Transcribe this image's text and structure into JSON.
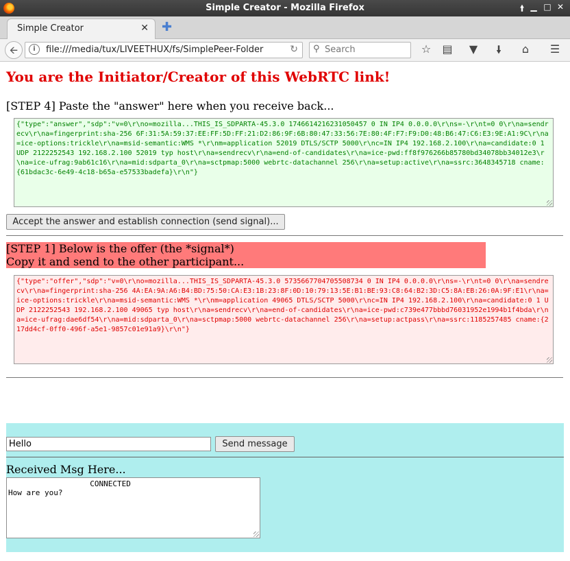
{
  "window": {
    "title": "Simple Creator - Mozilla Firefox"
  },
  "tabs": [
    {
      "label": "Simple Creator"
    }
  ],
  "toolbar": {
    "url": "file:///media/tux/LIVEETHUX/fs/SimplePeer-Folder",
    "search_placeholder": "Search"
  },
  "page": {
    "heading": "You are the Initiator/Creator of this WebRTC link!",
    "step4_label": "[STEP 4] Paste the \"answer\" here when you receive back...",
    "answer_text": "{\"type\":\"answer\",\"sdp\":\"v=0\\r\\no=mozilla...THIS_IS_SDPARTA-45.3.0 1746614216231050457 0 IN IP4 0.0.0.0\\r\\ns=-\\r\\nt=0 0\\r\\na=sendrecv\\r\\na=fingerprint:sha-256 6F:31:5A:59:37:EE:FF:5D:FF:21:D2:86:9F:6B:80:47:33:56:7E:80:4F:F7:F9:D0:48:B6:47:C6:E3:9E:A1:9C\\r\\na=ice-options:trickle\\r\\na=msid-semantic:WMS *\\r\\nm=application 52019 DTLS/SCTP 5000\\r\\nc=IN IP4 192.168.2.100\\r\\na=candidate:0 1 UDP 2122252543 192.168.2.100 52019 typ host\\r\\na=sendrecv\\r\\na=end-of-candidates\\r\\na=ice-pwd:ff8f976266b85780bd34078bb34012e3\\r\\na=ice-ufrag:9ab61c16\\r\\na=mid:sdparta_0\\r\\na=sctpmap:5000 webrtc-datachannel 256\\r\\na=setup:active\\r\\na=ssrc:3648345718 cname:{61bdac3c-6e49-4c18-b65a-e57533badefa}\\r\\n\"}",
    "accept_button": "Accept the answer and establish connection (send signal)...",
    "step1_line1": "[STEP 1] Below is the offer (the *signal*)",
    "step1_line2": "Copy it and send to the other participant...",
    "offer_text": "{\"type\":\"offer\",\"sdp\":\"v=0\\r\\no=mozilla...THIS_IS_SDPARTA-45.3.0 5735667704705508734 0 IN IP4 0.0.0.0\\r\\ns=-\\r\\nt=0 0\\r\\na=sendrecv\\r\\na=fingerprint:sha-256 4A:EA:9A:A6:B4:BD:75:50:CA:E3:1B:23:8F:0D:10:79:13:5E:B1:BE:93:C8:64:B2:3D:C5:8A:EB:26:0A:9F:E1\\r\\na=ice-options:trickle\\r\\na=msid-semantic:WMS *\\r\\nm=application 49065 DTLS/SCTP 5000\\r\\nc=IN IP4 192.168.2.100\\r\\na=candidate:0 1 UDP 2122252543 192.168.2.100 49065 typ host\\r\\na=sendrecv\\r\\na=end-of-candidates\\r\\na=ice-pwd:c739e477bbbd76031952e1994b1f4bda\\r\\na=ice-ufrag:dae6df54\\r\\na=mid:sdparta_0\\r\\na=sctpmap:5000 webrtc-datachannel 256\\r\\na=setup:actpass\\r\\na=ssrc:1185257485 cname:{217dd4cf-0ff0-496f-a5e1-9857c01e91a9}\\r\\n\"}",
    "message_value": "Hello",
    "send_button": "Send message",
    "received_label": "Received Msg Here...",
    "received_text": "                  CONNECTED\nHow are you?"
  }
}
